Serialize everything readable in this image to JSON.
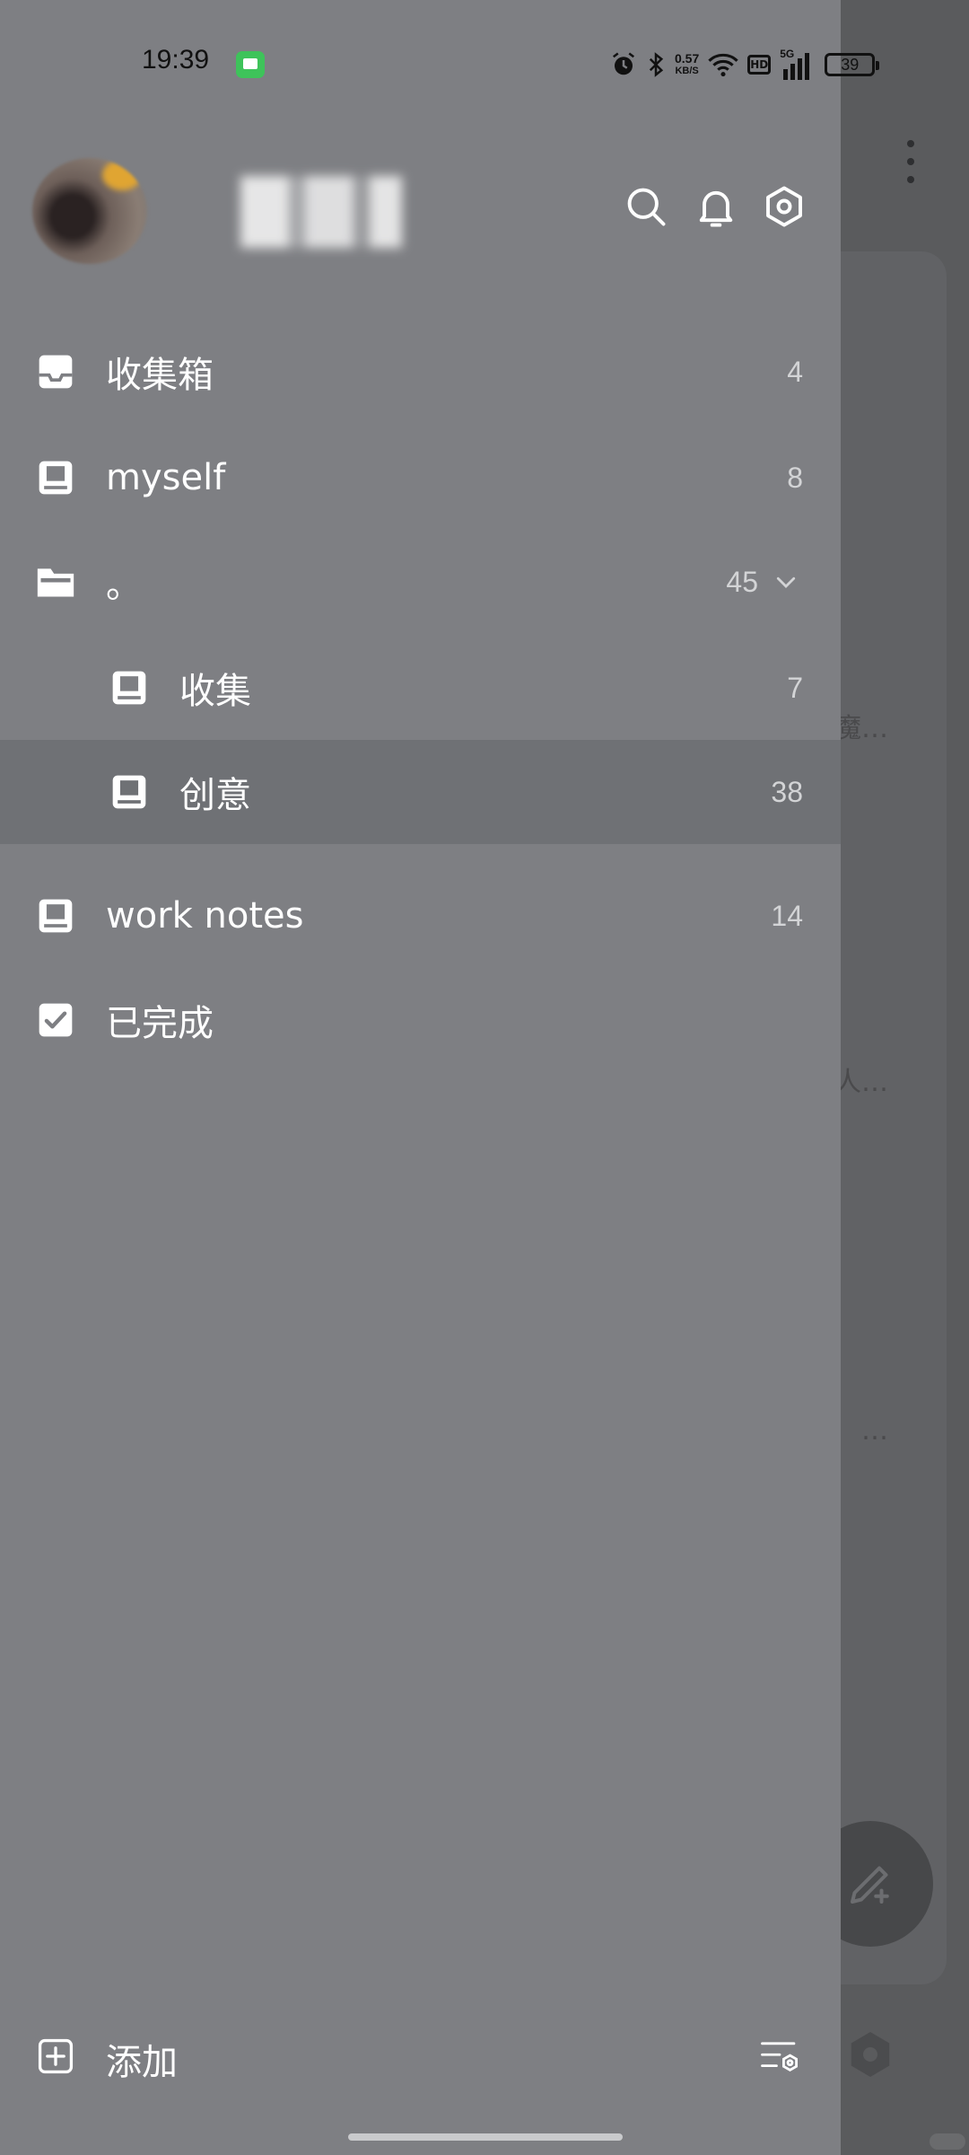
{
  "status_bar": {
    "time": "19:39",
    "net_speed_value": "0.57",
    "net_speed_unit": "KB/S",
    "hd": "HD",
    "network": "5G",
    "battery": "39"
  },
  "drawer": {
    "items": [
      {
        "label": "收集箱",
        "count": "4",
        "icon": "inbox-icon"
      },
      {
        "label": "myself",
        "count": "8",
        "icon": "notebook-icon"
      },
      {
        "label": "。",
        "count": "45",
        "icon": "folder-open-icon"
      },
      {
        "label": "收集",
        "count": "7",
        "icon": "notebook-icon"
      },
      {
        "label": "创意",
        "count": "38",
        "icon": "notebook-icon"
      },
      {
        "label": "work notes",
        "count": "14",
        "icon": "notebook-icon"
      },
      {
        "label": "已完成",
        "count": "",
        "icon": "checkbox-checked-icon"
      }
    ],
    "footer": {
      "add_label": "添加"
    }
  },
  "background": {
    "snippets": [
      "魔…",
      "人…",
      "…"
    ]
  },
  "colors": {
    "drawer_bg": "#7e7f83",
    "selected_bg": "#6f7175",
    "scrim_bg": "#5a5b5d",
    "status_green": "#3ec35a"
  }
}
